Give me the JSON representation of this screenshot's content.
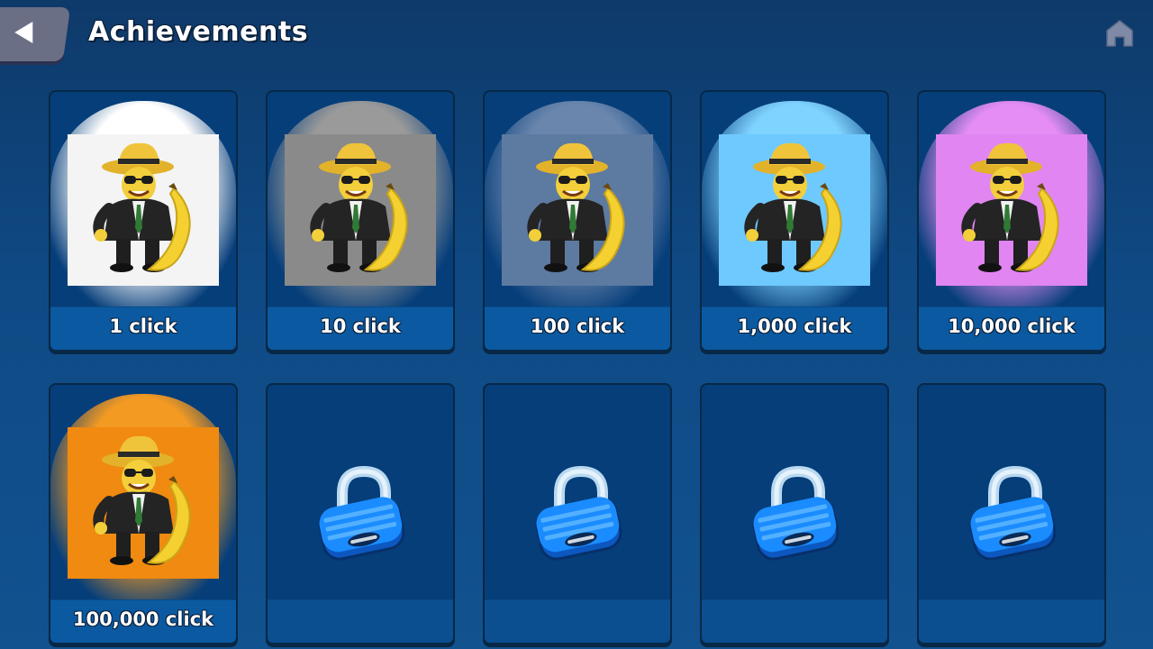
{
  "header": {
    "title": "Achievements",
    "back_icon": "back-arrow-icon",
    "home_icon": "home-icon"
  },
  "achievements": [
    {
      "label": "1 click",
      "unlocked": true,
      "bg": "#f4f4f4",
      "glow": "#ffffff"
    },
    {
      "label": "10 click",
      "unlocked": true,
      "bg": "#8a8a8a",
      "glow": "#9a9a9a"
    },
    {
      "label": "100 click",
      "unlocked": true,
      "bg": "#5d7aa0",
      "glow": "#6a86ad"
    },
    {
      "label": "1,000 click",
      "unlocked": true,
      "bg": "#6ec9ff",
      "glow": "#7fd3ff"
    },
    {
      "label": "10,000 click",
      "unlocked": true,
      "bg": "#e085f2",
      "glow": "#e58df5"
    },
    {
      "label": "100,000 click",
      "unlocked": true,
      "bg": "#f08a10",
      "glow": "#f39a22"
    },
    {
      "label": "",
      "unlocked": false
    },
    {
      "label": "",
      "unlocked": false
    },
    {
      "label": "",
      "unlocked": false
    },
    {
      "label": "",
      "unlocked": false
    }
  ],
  "colors": {
    "background": "#0f4a85",
    "card": "#063e7a",
    "label_bar": "#0b5aa1",
    "lock_blue": "#1a8cff"
  }
}
